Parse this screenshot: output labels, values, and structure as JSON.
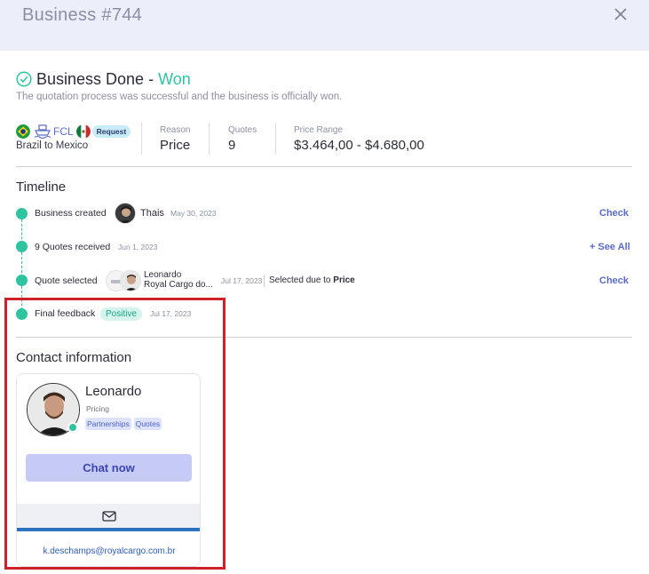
{
  "header": {
    "title": "Business #744"
  },
  "status": {
    "title": "Business Done -",
    "outcome": "Won",
    "description": "The quotation process was successful and the business is officially won."
  },
  "summary": {
    "mode": "FCL",
    "request_badge": "Request",
    "route": "Brazil to Mexico",
    "reason_label": "Reason",
    "reason_value": "Price",
    "quotes_label": "Quotes",
    "quotes_value": "9",
    "price_label": "Price Range",
    "price_value": "$3.464,00 - $4.680,00"
  },
  "timeline": {
    "title": "Timeline",
    "items": [
      {
        "label": "Business created",
        "name": "Thais",
        "date": "May 30, 2023",
        "action": "Check"
      },
      {
        "label": "9 Quotes received",
        "date": "Jun 1, 2023",
        "action": "+ See All"
      },
      {
        "label": "Quote selected",
        "name": "Leonardo",
        "company": "Royal Cargo do...",
        "date": "Jul 17, 2023",
        "note_prefix": "Selected due to",
        "note_value": "Price",
        "action": "Check"
      },
      {
        "label": "Final feedback",
        "badge": "Positive",
        "date": "Jul 17, 2023"
      }
    ]
  },
  "contact": {
    "title": "Contact information",
    "name": "Leonardo",
    "role": "Pricing",
    "tags": [
      "Partnerships",
      "Quotes"
    ],
    "chat_label": "Chat now",
    "email": "k.deschamps@royalcargo.com.br"
  },
  "colors": {
    "accent_green": "#2ec4a0",
    "accent_blue": "#5b6bc9",
    "highlight_red": "#d0202a"
  }
}
